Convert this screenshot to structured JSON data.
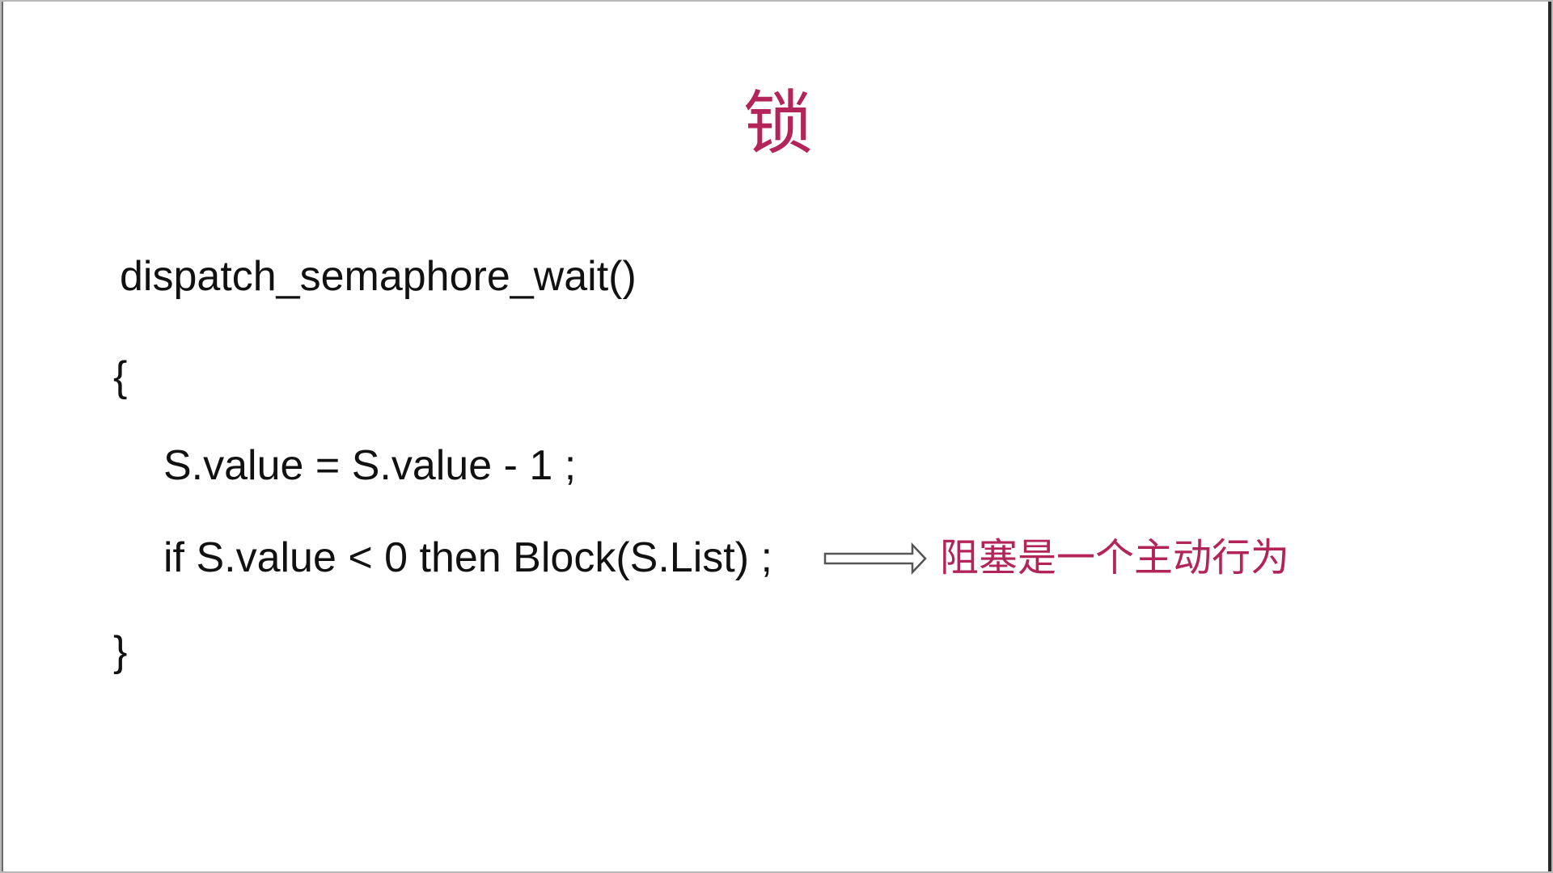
{
  "slide": {
    "title": "锁",
    "code": {
      "signature": "dispatch_semaphore_wait()",
      "open_brace": "{",
      "decrement": "S.value = S.value - 1 ;",
      "condition": "if S.value < 0 then Block(S.List) ;",
      "close_brace": "}"
    },
    "annotation": {
      "icon": "right-arrow-icon",
      "text": "阻塞是一个主动行为"
    }
  },
  "colors": {
    "accent": "#b3245a",
    "text": "#111111",
    "background": "#ffffff"
  }
}
